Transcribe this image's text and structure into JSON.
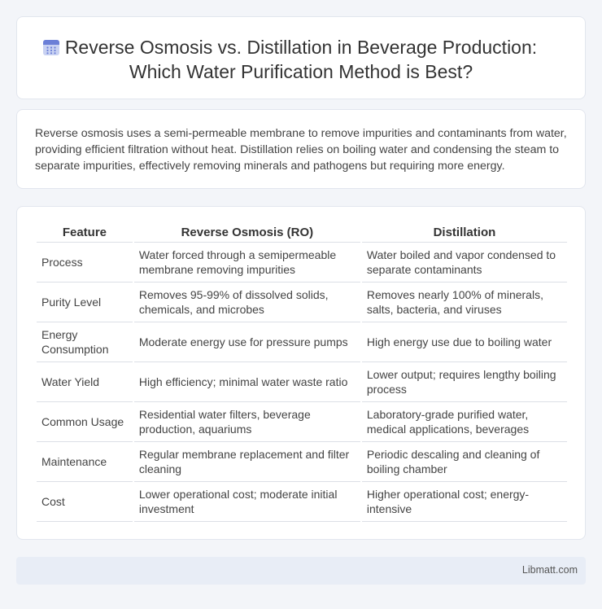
{
  "title": {
    "line1": "Reverse Osmosis vs. Distillation in Beverage Production:",
    "line2": "Which Water Purification Method is Best?",
    "icon": "calendar-icon"
  },
  "summary": "Reverse osmosis uses a semi-permeable membrane to remove impurities and contaminants from water, providing efficient filtration without heat. Distillation relies on boiling water and condensing the steam to separate impurities, effectively removing minerals and pathogens but requiring more energy.",
  "table": {
    "headers": [
      "Feature",
      "Reverse Osmosis (RO)",
      "Distillation"
    ],
    "rows": [
      [
        "Process",
        "Water forced through a semipermeable membrane removing impurities",
        "Water boiled and vapor condensed to separate contaminants"
      ],
      [
        "Purity Level",
        "Removes 95-99% of dissolved solids, chemicals, and microbes",
        "Removes nearly 100% of minerals, salts, bacteria, and viruses"
      ],
      [
        "Energy Consumption",
        "Moderate energy use for pressure pumps",
        "High energy use due to boiling water"
      ],
      [
        "Water Yield",
        "High efficiency; minimal water waste ratio",
        "Lower output; requires lengthy boiling process"
      ],
      [
        "Common Usage",
        "Residential water filters, beverage production, aquariums",
        "Laboratory-grade purified water, medical applications, beverages"
      ],
      [
        "Maintenance",
        "Regular membrane replacement and filter cleaning",
        "Periodic descaling and cleaning of boiling chamber"
      ],
      [
        "Cost",
        "Lower operational cost; moderate initial investment",
        "Higher operational cost; energy-intensive"
      ]
    ]
  },
  "footer": "Libmatt.com",
  "colors": {
    "icon_accent": "#6b7fd7",
    "icon_light": "#c9d2f2"
  }
}
